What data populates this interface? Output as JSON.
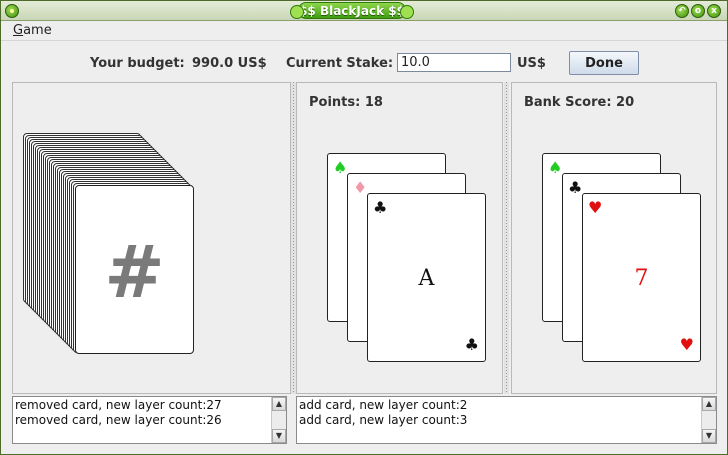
{
  "window": {
    "title": "$$ BlackJack $$",
    "controls": {
      "minimize": "↶",
      "maximize": "o",
      "close": "x"
    }
  },
  "menu": {
    "items": [
      {
        "mnemonic": "G",
        "rest": "ame"
      }
    ]
  },
  "toolbar": {
    "budget_label": "Your budget:",
    "budget_value": "990.0 US$",
    "stake_label": "Current Stake:",
    "stake_value": "10.0",
    "currency": "US$",
    "done_label": "Done"
  },
  "deck": {
    "symbol": "#",
    "layer_count": 26
  },
  "player": {
    "points_label": "Points: 18",
    "cards": [
      {
        "corner": "♠",
        "corner_color": "green"
      },
      {
        "corner": "♦",
        "corner_color": "pink"
      },
      {
        "corner": "♣",
        "corner_color": "black",
        "rank": "A",
        "bottom": "♣"
      }
    ]
  },
  "bank": {
    "score_label": "Bank Score: 20",
    "cards": [
      {
        "corner": "♠",
        "corner_color": "green"
      },
      {
        "corner": "♣",
        "corner_color": "black"
      },
      {
        "corner": "♥",
        "corner_color": "red",
        "rank": "7",
        "bottom": "♥"
      }
    ]
  },
  "logs": {
    "deck": [
      "removed card, new layer count:27",
      "removed card, new layer count:26"
    ],
    "table": [
      "add card, new layer count:2",
      "add card, new layer count:3"
    ]
  },
  "scroll": {
    "up": "▲",
    "down": "▼"
  }
}
